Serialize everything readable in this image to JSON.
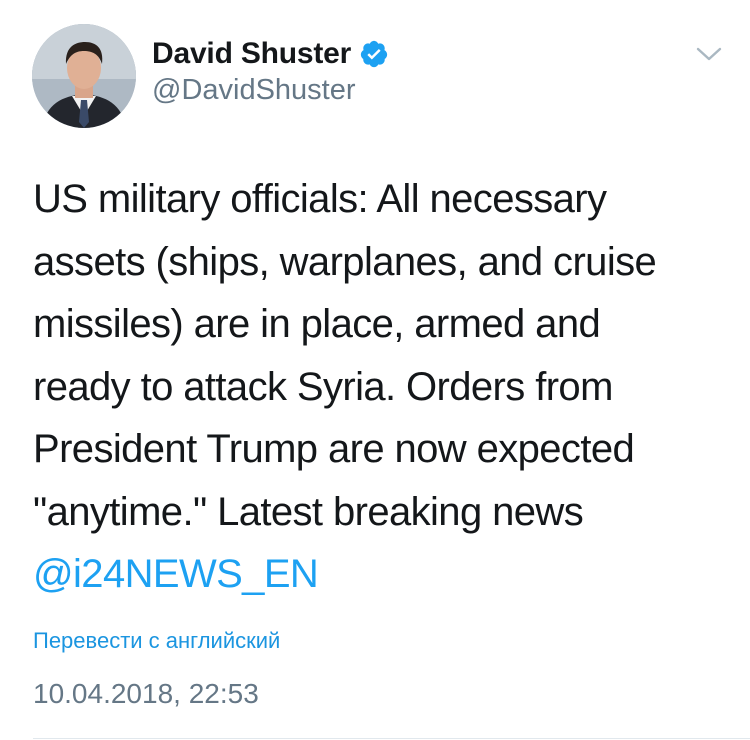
{
  "author": {
    "display_name": "David Shuster",
    "handle": "@DavidShuster",
    "verified": true,
    "verified_color": "#1da1f2"
  },
  "tweet": {
    "text": "US military officials:  All necessary\nassets (ships, warplanes, and cruise\nmissiles) are in place, armed and\nready to attack Syria.  Orders from\nPresident Trump are now expected\n\"anytime.\"  Latest breaking news",
    "mention": "@i24NEWS_EN",
    "mention_color": "#1da1f2"
  },
  "translate_link": "Перевести с английский",
  "timestamp": "10.04.2018, 22:53",
  "icons": {
    "avatar": "avatar",
    "verified": "verified-badge-icon",
    "more": "chevron-down-icon"
  }
}
